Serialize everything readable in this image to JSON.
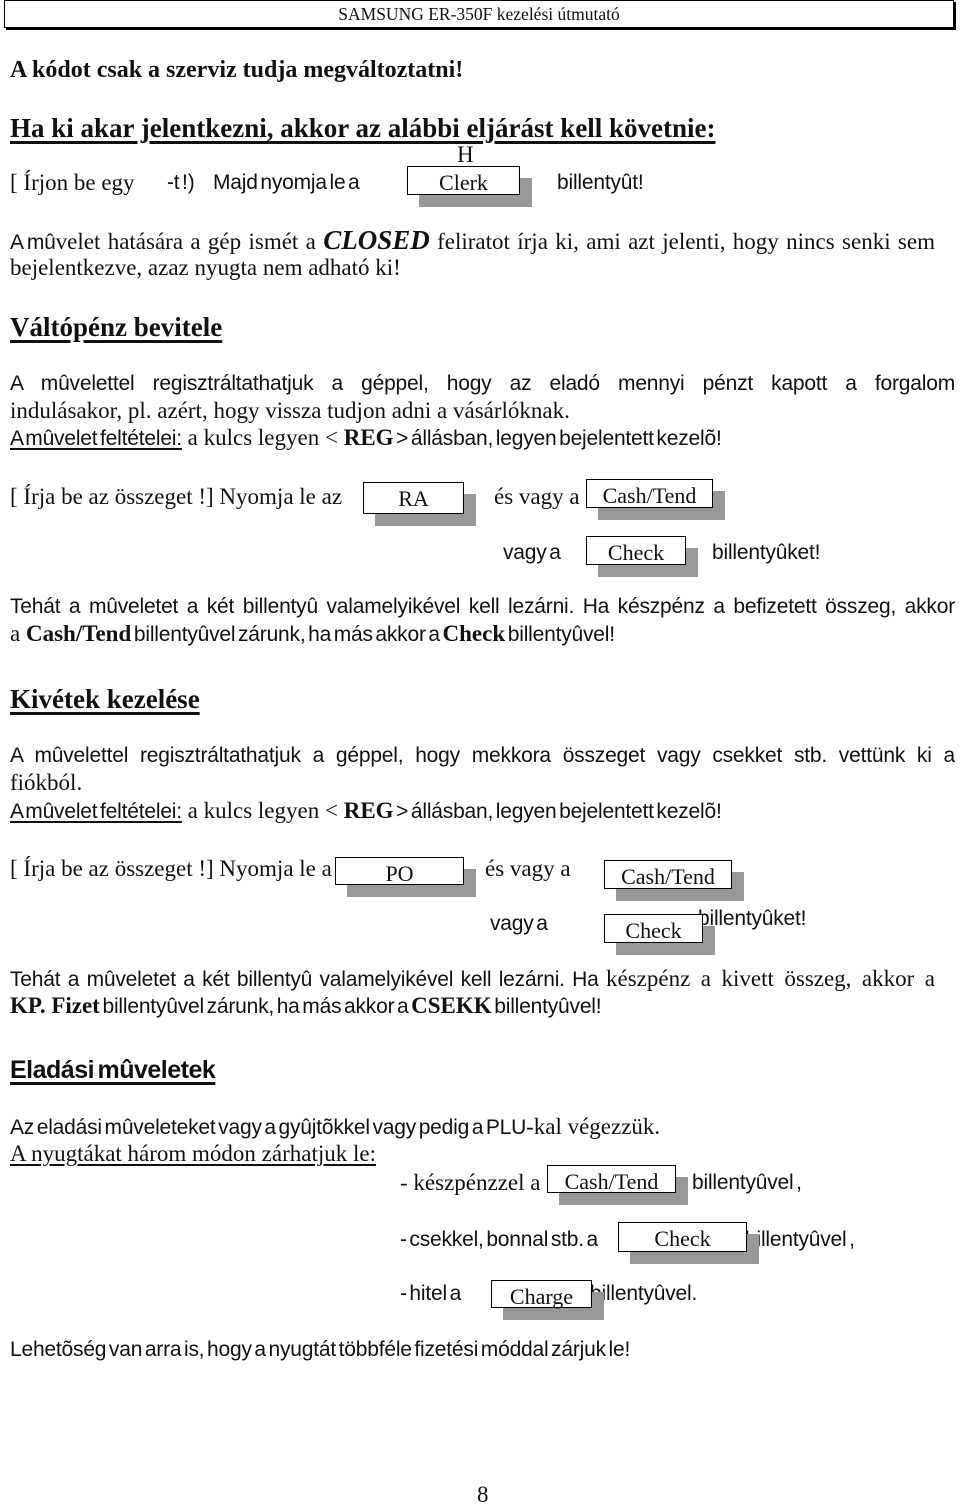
{
  "header": {
    "title": "SAMSUNG ER-350F kezelési útmutató"
  },
  "notice": "A kódot csak a szerviz tudja megváltoztatni!",
  "logout": {
    "heading": "Ha ki akar jelentkezni, akkor az alábbi eljárást kell követnie:",
    "key_caption": "H",
    "step": [
      "[ Írjon be egy",
      "-t !)",
      "Majd nyomja le a",
      "billentyût!"
    ],
    "key": "Clerk",
    "result": {
      "line1": [
        "A mû",
        "velet hatására a gép ismét a ",
        "CLOSED",
        " feliratot írja ki, ami azt jelenti, hogy nincs senki sem"
      ],
      "line2": "bejelentkezve, azaz nyugta nem adható ki!"
    }
  },
  "float_entry": {
    "heading": "Váltópénz bevitele",
    "description": [
      "A mûvelettel regisztráltathatjuk a géppel, hogy az eladó mennyi pénzt kapott a forgalom",
      "indulásakor, pl. azért, hogy vissza tudjon adni a vásárlóknak."
    ],
    "conditions": [
      "A mûvelet feltételei:",
      " a kulcs legyen < ",
      "REG",
      " > állásban, legyen bejelentett kezelõ!"
    ],
    "step": {
      "text": "[ Írja be az összeget !] Nyomja le az",
      "or": "és vagy a",
      "or2": "vagy a",
      "end": "billentyûket!"
    },
    "keys": [
      "RA",
      "Cash/Tend",
      "Check"
    ],
    "summary": {
      "line1": "Tehát a mûveletet a két billentyû valamelyikével kell lezárni. Ha készpénz a befizetett összeg, akkor",
      "line2": [
        "a ",
        "Cash/Tend",
        " billentyûvel zárunk, ha más akkor a ",
        "Check",
        " billentyûvel!"
      ]
    }
  },
  "withdrawal": {
    "heading": "Kivétek kezelése",
    "description": [
      "A mûvelettel regisztráltathatjuk a géppel, hogy mekkora összeget vagy csekket stb. vettünk ki a",
      "fiókból."
    ],
    "conditions": [
      "A mûvelet feltételei:",
      " a kulcs legyen < ",
      "REG",
      " > állásban, legyen bejelentett kezelõ!"
    ],
    "step": {
      "text": "[ Írja be az összeget !] Nyomja le a",
      "or": "és vagy a",
      "or2": "vagy a",
      "end": "billentyûket!"
    },
    "keys": [
      "PO",
      "Cash/Tend",
      "Check"
    ],
    "summary": {
      "line1": [
        "Tehát a mûveletet a két billentyû valamelyikével kell lezárni. Ha ",
        "készpénz a kivett összeg, akkor a"
      ],
      "line2": [
        "KP. Fizet",
        " billentyûvel zárunk, ha más akkor a ",
        "CSEKK",
        " billentyûvel!"
      ]
    }
  },
  "sales": {
    "heading": "Eladási mûveletek",
    "intro": [
      "Az eladási mûveleteket vagy a gyûjtõkkel vagy pedig a PLU",
      "-kal végezzük."
    ],
    "closing_label": "A nyugtákat három módon zárhatjuk le:",
    "options": [
      {
        "text": "- készpénzzel a",
        "key": "Cash/Tend",
        "end": "billentyûvel ,"
      },
      {
        "text": "- csekkel, bonnal stb. a",
        "key": "Check",
        "end": "billentyûvel ,"
      },
      {
        "text": "- hitel a",
        "key": "Charge",
        "end": "billentyûvel."
      }
    ],
    "note": "Lehetõség van arra is, hogy a nyugtát többféle fizetési móddal zárjuk le!"
  },
  "footer": {
    "page_number": "8"
  }
}
